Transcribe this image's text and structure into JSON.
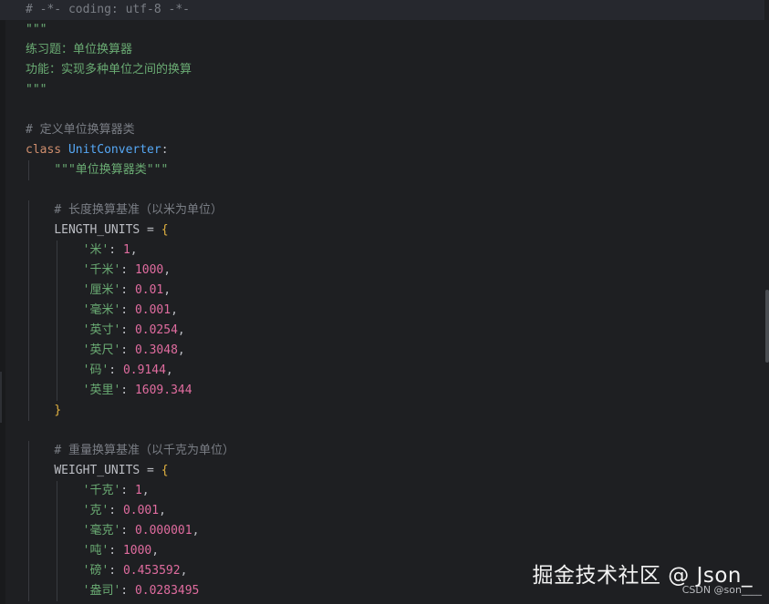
{
  "editor": {
    "lines": [
      [
        {
          "t": "# -*- coding: utf-8 -*-",
          "c": "tok-comment"
        }
      ],
      [
        {
          "t": "\"\"\"",
          "c": "tok-docgreen"
        }
      ],
      [
        {
          "t": "练习题：单位换算器",
          "c": "tok-docgreen"
        }
      ],
      [
        {
          "t": "功能：实现多种单位之间的换算",
          "c": "tok-docgreen"
        }
      ],
      [
        {
          "t": "\"\"\"",
          "c": "tok-docgreen"
        }
      ],
      [],
      [
        {
          "t": "# 定义单位换算器类",
          "c": "tok-comment"
        }
      ],
      [
        {
          "t": "class ",
          "c": "tok-keyword"
        },
        {
          "t": "UnitConverter",
          "c": "tok-class"
        },
        {
          "t": ":",
          "c": "tok-punct"
        }
      ],
      [
        {
          "t": "    "
        },
        {
          "t": "\"\"\"单位换算器类\"\"\"",
          "c": "tok-docgreen"
        }
      ],
      [],
      [
        {
          "t": "    "
        },
        {
          "t": "# 长度换算基准（以米为单位）",
          "c": "tok-comment"
        }
      ],
      [
        {
          "t": "    "
        },
        {
          "t": "LENGTH_UNITS",
          "c": "tok-ident"
        },
        {
          "t": " = ",
          "c": "tok-op"
        },
        {
          "t": "{",
          "c": "tok-brace"
        }
      ],
      [
        {
          "t": "        "
        },
        {
          "t": "'米'",
          "c": "tok-string"
        },
        {
          "t": ": ",
          "c": "tok-punct"
        },
        {
          "t": "1",
          "c": "tok-num-pink"
        },
        {
          "t": ",",
          "c": "tok-punct"
        }
      ],
      [
        {
          "t": "        "
        },
        {
          "t": "'千米'",
          "c": "tok-string"
        },
        {
          "t": ": ",
          "c": "tok-punct"
        },
        {
          "t": "1000",
          "c": "tok-num-pink"
        },
        {
          "t": ",",
          "c": "tok-punct"
        }
      ],
      [
        {
          "t": "        "
        },
        {
          "t": "'厘米'",
          "c": "tok-string"
        },
        {
          "t": ": ",
          "c": "tok-punct"
        },
        {
          "t": "0.01",
          "c": "tok-num-pink"
        },
        {
          "t": ",",
          "c": "tok-punct"
        }
      ],
      [
        {
          "t": "        "
        },
        {
          "t": "'毫米'",
          "c": "tok-string"
        },
        {
          "t": ": ",
          "c": "tok-punct"
        },
        {
          "t": "0.001",
          "c": "tok-num-pink"
        },
        {
          "t": ",",
          "c": "tok-punct"
        }
      ],
      [
        {
          "t": "        "
        },
        {
          "t": "'英寸'",
          "c": "tok-string"
        },
        {
          "t": ": ",
          "c": "tok-punct"
        },
        {
          "t": "0.0254",
          "c": "tok-num-pink"
        },
        {
          "t": ",",
          "c": "tok-punct"
        }
      ],
      [
        {
          "t": "        "
        },
        {
          "t": "'英尺'",
          "c": "tok-string"
        },
        {
          "t": ": ",
          "c": "tok-punct"
        },
        {
          "t": "0.3048",
          "c": "tok-num-pink"
        },
        {
          "t": ",",
          "c": "tok-punct"
        }
      ],
      [
        {
          "t": "        "
        },
        {
          "t": "'码'",
          "c": "tok-string"
        },
        {
          "t": ": ",
          "c": "tok-punct"
        },
        {
          "t": "0.9144",
          "c": "tok-num-pink"
        },
        {
          "t": ",",
          "c": "tok-punct"
        }
      ],
      [
        {
          "t": "        "
        },
        {
          "t": "'英里'",
          "c": "tok-string"
        },
        {
          "t": ": ",
          "c": "tok-punct"
        },
        {
          "t": "1609.344",
          "c": "tok-num-pink"
        }
      ],
      [
        {
          "t": "    "
        },
        {
          "t": "}",
          "c": "tok-brace"
        }
      ],
      [],
      [
        {
          "t": "    "
        },
        {
          "t": "# 重量换算基准（以千克为单位）",
          "c": "tok-comment"
        }
      ],
      [
        {
          "t": "    "
        },
        {
          "t": "WEIGHT_UNITS",
          "c": "tok-ident"
        },
        {
          "t": " = ",
          "c": "tok-op"
        },
        {
          "t": "{",
          "c": "tok-brace"
        }
      ],
      [
        {
          "t": "        "
        },
        {
          "t": "'千克'",
          "c": "tok-string"
        },
        {
          "t": ": ",
          "c": "tok-punct"
        },
        {
          "t": "1",
          "c": "tok-num-pink"
        },
        {
          "t": ",",
          "c": "tok-punct"
        }
      ],
      [
        {
          "t": "        "
        },
        {
          "t": "'克'",
          "c": "tok-string"
        },
        {
          "t": ": ",
          "c": "tok-punct"
        },
        {
          "t": "0.001",
          "c": "tok-num-pink"
        },
        {
          "t": ",",
          "c": "tok-punct"
        }
      ],
      [
        {
          "t": "        "
        },
        {
          "t": "'毫克'",
          "c": "tok-string"
        },
        {
          "t": ": ",
          "c": "tok-punct"
        },
        {
          "t": "0.000001",
          "c": "tok-num-pink"
        },
        {
          "t": ",",
          "c": "tok-punct"
        }
      ],
      [
        {
          "t": "        "
        },
        {
          "t": "'吨'",
          "c": "tok-string"
        },
        {
          "t": ": ",
          "c": "tok-punct"
        },
        {
          "t": "1000",
          "c": "tok-num-pink"
        },
        {
          "t": ",",
          "c": "tok-punct"
        }
      ],
      [
        {
          "t": "        "
        },
        {
          "t": "'磅'",
          "c": "tok-string"
        },
        {
          "t": ": ",
          "c": "tok-punct"
        },
        {
          "t": "0.453592",
          "c": "tok-num-pink"
        },
        {
          "t": ",",
          "c": "tok-punct"
        }
      ],
      [
        {
          "t": "        "
        },
        {
          "t": "'盎司'",
          "c": "tok-string"
        },
        {
          "t": ": ",
          "c": "tok-punct"
        },
        {
          "t": "0.0283495",
          "c": "tok-num-pink"
        }
      ]
    ]
  },
  "watermark": {
    "main": "掘金技术社区 @ Json_",
    "sub": "CSDN @son____"
  },
  "colors": {
    "background": "#1e1f22",
    "comment": "#7a7e85",
    "docstring": "#6aab73",
    "keyword": "#cf8e6d",
    "class_name": "#56a8f5",
    "brace": "#e3b341",
    "number": "#e06c9f"
  }
}
